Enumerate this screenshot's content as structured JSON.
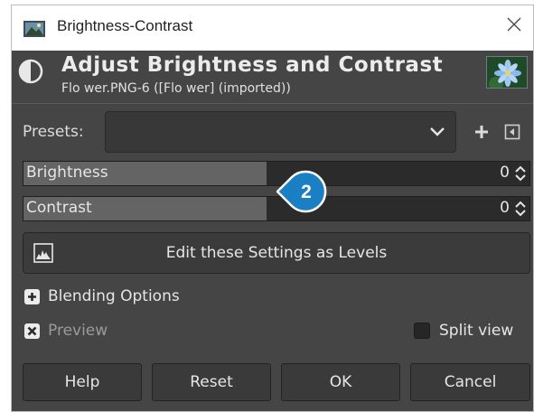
{
  "window": {
    "title": "Brightness-Contrast",
    "app_icon": "gimp-app-icon",
    "close_icon": "close-icon"
  },
  "header": {
    "title": "Adjust Brightness and Contrast",
    "subtitle": "Flo wer.PNG-6 ([Flo wer] (imported))",
    "icon": "brightness-contrast-icon",
    "thumbnail": "flower-image-thumbnail"
  },
  "presets": {
    "label": "Presets:",
    "value": "",
    "add_icon": "plus-icon",
    "menu_icon": "menu-icon"
  },
  "brightness": {
    "label": "Brightness",
    "value": "0",
    "fill_fraction": 0.48
  },
  "contrast": {
    "label": "Contrast",
    "value": "0",
    "fill_fraction": 0.48
  },
  "callout": {
    "number": "2",
    "color": "#1b7fc4"
  },
  "levels_button": {
    "label": "Edit these Settings as Levels",
    "icon": "levels-icon"
  },
  "blending": {
    "label": "Blending Options",
    "icon": "expand-plus-icon"
  },
  "preview": {
    "label": "Preview",
    "checked": true
  },
  "split_view": {
    "label": "Split view",
    "checked": false
  },
  "buttons": {
    "help": "Help",
    "reset": "Reset",
    "ok": "OK",
    "cancel": "Cancel"
  },
  "colors": {
    "dialog_bg": "#454545",
    "field_bg": "#2b2b2b",
    "slider_fill": "#646464",
    "text": "#e6e6e6"
  }
}
